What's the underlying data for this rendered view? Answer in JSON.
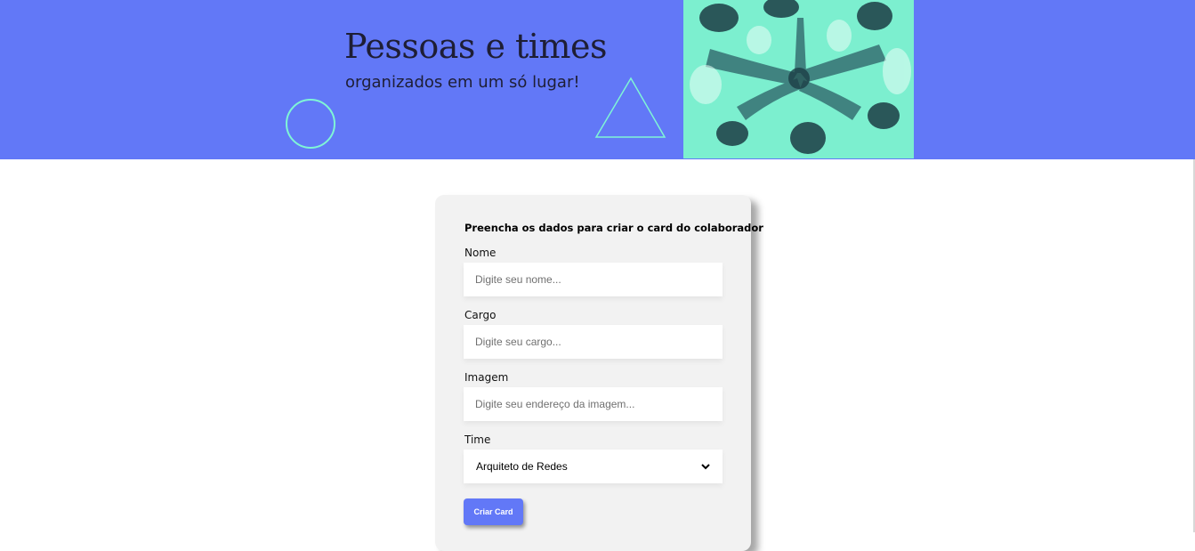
{
  "banner": {
    "title": "Pessoas e times",
    "subtitle": "organizados em um só lugar!",
    "background_color": "#6278f7",
    "accent_color": "#7ff5d6",
    "photo_tint": "#7cefcf"
  },
  "form": {
    "heading": "Preencha os dados para criar o card do colaborador",
    "fields": [
      {
        "label": "Nome",
        "placeholder": "Digite seu nome..."
      },
      {
        "label": "Cargo",
        "placeholder": "Digite seu cargo..."
      },
      {
        "label": "Imagem",
        "placeholder": "Digite seu endereço da imagem..."
      }
    ],
    "team": {
      "label": "Time",
      "selected": "Arquiteto de Redes",
      "icon": "chevron-down-icon"
    },
    "submit_label": "Criar Card"
  }
}
